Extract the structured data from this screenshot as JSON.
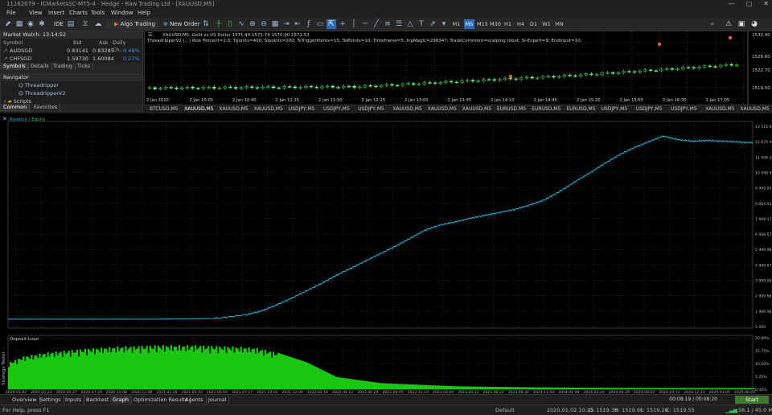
{
  "window": {
    "title": "11162079 - ICMarketsSC-MT5-4 - Hedge - Raw Trading Ltd - [XAUUSD,M5]",
    "controls": [
      "—",
      "▢",
      "✕"
    ]
  },
  "menu": [
    "File",
    "View",
    "Insert",
    "Charts",
    "Tools",
    "Window",
    "Help"
  ],
  "toolbar": {
    "ide_label": "IDE",
    "algo_label": "Algo Trading",
    "new_order_label": "New Order",
    "timeframes": [
      "M1",
      "M5",
      "M15",
      "M30",
      "H1",
      "H4",
      "D1",
      "W1",
      "MN"
    ],
    "active_timeframe": "M5"
  },
  "market_watch": {
    "title": "Market Watch: 13:14:52",
    "columns": [
      "Symbol",
      "Bid",
      "Ask",
      "Daily Ch..."
    ],
    "rows": [
      {
        "symbol": "AUDSGD",
        "bid": "0.83141",
        "ask": "0.83285",
        "change": "0.48%"
      },
      {
        "symbol": "CHFSGD",
        "bid": "1.59730",
        "ask": "1.60084",
        "change": "0.27%"
      }
    ],
    "tabs": [
      "Symbols",
      "Details",
      "Trading",
      "Ticks"
    ]
  },
  "navigator": {
    "title": "Navigator",
    "items": [
      "Threadripper",
      "ThreadripperV2",
      "Scripts"
    ],
    "tabs": [
      "Common",
      "Favorites"
    ]
  },
  "chart": {
    "symbol_line": "XAUUSD,M5: Gold vs US Dollar 1571.44 1571.74 1570.90 1571.53",
    "ea_line": "ThreadripperV2 (...) Risk Percent=2.0; Tpoints=400; Slpoints=200; TsTriggerPoints=15; TslPoints=10; Timeframe=5; InpMagic=298347; TradeComment=scalping robot; SI-Expert=9; EndInput=10;",
    "price_labels": [
      "1532.40",
      "1526.60",
      "1522.70",
      "1519.50"
    ],
    "time_labels": [
      "2 Jan 2020",
      "2 Jan 10:05",
      "2 Jan 10:40",
      "2 Jan 11:15",
      "2 Jan 11:50",
      "2 Jan 12:25",
      "2 Jan 13:00",
      "2 Jan 13:35",
      "2 Jan 14:10",
      "2 Jan 14:45",
      "2 Jan 15:20",
      "2 Jan 15:55",
      "2 Jan 16:30",
      "2 Jan 17:05"
    ],
    "tabs": [
      "BTCUSD,M5",
      "XAUUSD,M5",
      "XAUUSD,M5",
      "XAUUSD,M5",
      "USDJPY,M5",
      "USDJPY,M5",
      "USDJPY,M5",
      "XAUUSD,M5",
      "XAUUSD,M5",
      "XAUUSD,M5",
      "EURUSD,M5",
      "EURUSD,M5",
      "EURUSD,M5",
      "USDJPY,M5",
      "USDJPY,M5",
      "USDJPY,M5",
      "XAUUSD,M5",
      "XAUUSD,M5",
      "XAU"
    ]
  },
  "chart_data": [
    {
      "type": "line",
      "title": "",
      "legend": [
        "Balance",
        "Equity"
      ],
      "legend_colors": [
        "#28a9d6",
        "#3fbf4f"
      ],
      "line_color": "#28a9d6",
      "y_tick_labels": [
        "13 516 065",
        "12 874 987",
        "11 999 264",
        "10 998 963",
        "9 999 954",
        "9 004 545",
        "7 999 175",
        "6 998 571",
        "5 999 982",
        "4 998 675",
        "3 999 568",
        "2 999 666",
        "1 999 965",
        "5 000"
      ],
      "x_tick_labels": [
        "2020.01.02",
        "2020.03.24",
        "2020.05.27",
        "2020.07.29",
        "2020.10.06",
        "2020.12.09",
        "2021.02.26",
        "2021.05.03",
        "2021.06.19",
        "2021.07.27",
        "2021.10.01",
        "2021.12.09",
        "2022.02.16",
        "2022.04.22",
        "2022.06.29",
        "2022.09.05",
        "2022.11.10",
        "2023.02.04",
        "2023.04.12",
        "2023.06.22",
        "2023.08.30",
        "2023.11.03",
        "2024.01.09",
        "2024.03.20",
        "2024.05.29",
        "2024.08.02",
        "2024.10.11",
        "2024.12.23",
        "2025.03.05",
        "2025.06.05"
      ],
      "x": [
        0,
        0.04,
        0.08,
        0.12,
        0.16,
        0.2,
        0.24,
        0.28,
        0.32,
        0.34,
        0.36,
        0.38,
        0.4,
        0.42,
        0.44,
        0.46,
        0.48,
        0.5,
        0.52,
        0.54,
        0.56,
        0.58,
        0.6,
        0.62,
        0.64,
        0.66,
        0.68,
        0.7,
        0.72,
        0.74,
        0.76,
        0.78,
        0.8,
        0.82,
        0.84,
        0.86,
        0.88,
        0.9,
        0.92,
        0.94,
        0.96,
        0.98,
        1.0
      ],
      "values": [
        400000,
        400000,
        400000,
        400000,
        400000,
        400000,
        410000,
        450000,
        700000,
        950000,
        1350000,
        1800000,
        2300000,
        2800000,
        3350000,
        3850000,
        4350000,
        4850000,
        5350000,
        5900000,
        6450000,
        6800000,
        7000000,
        7250000,
        7450000,
        7650000,
        7850000,
        8150000,
        8500000,
        9050000,
        9700000,
        10300000,
        10950000,
        11550000,
        12050000,
        12450000,
        12850000,
        12600000,
        12500000,
        12550000,
        12500000,
        12450000,
        12400000
      ],
      "ylim": [
        5000,
        13516065
      ]
    },
    {
      "type": "area",
      "title": "Deposit Load",
      "color": "#19c80f",
      "y_tick_labels": [
        "20.99%",
        "15.75%",
        "10.50%",
        "5.25%",
        "0.00%"
      ],
      "x": [
        0,
        0.02,
        0.05,
        0.1,
        0.15,
        0.2,
        0.25,
        0.3,
        0.33,
        0.36,
        0.4,
        0.44,
        0.5,
        0.6,
        0.7,
        0.8,
        0.9,
        1.0
      ],
      "values": [
        11.0,
        13.5,
        15.0,
        16.5,
        17.5,
        18.0,
        18.0,
        17.5,
        17.0,
        15.0,
        11.0,
        5.0,
        2.5,
        1.2,
        0.8,
        0.6,
        0.5,
        0.5
      ],
      "ylim": [
        0,
        20.99
      ]
    }
  ],
  "tester": {
    "side_label": "Strategy Tester",
    "tabs": [
      "Overview",
      "Settings",
      "Inputs",
      "Backtest",
      "Graph",
      "Optimization Results",
      "Agents",
      "Journal"
    ],
    "active_tab": "Graph",
    "timer": "00:08:19 / 00:08:20",
    "start_label": "Start"
  },
  "status": {
    "help": "For Help, press F1",
    "profile": "Default",
    "datetime": "2020.01.02 10:25",
    "open": "O: 1519.36",
    "high": "H: 1519.91",
    "low": "L: 1519.20",
    "close": "C: 1519.55",
    "connection": "56.1 / 45.0 Mb"
  }
}
